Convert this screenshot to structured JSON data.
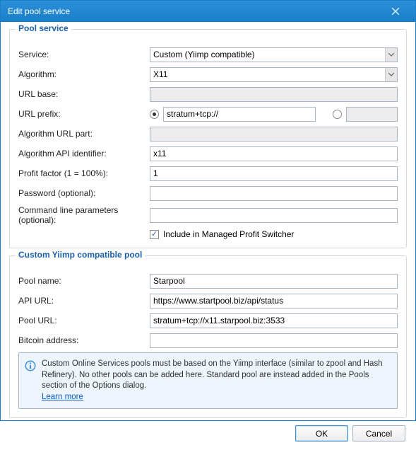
{
  "window": {
    "title": "Edit pool service"
  },
  "group1": {
    "title": "Pool service",
    "labels": {
      "service": "Service:",
      "algorithm": "Algorithm:",
      "url_base": "URL base:",
      "url_prefix": "URL prefix:",
      "algo_url_part": "Algorithm URL part:",
      "algo_api_id": "Algorithm API identifier:",
      "profit_factor": "Profit factor (1 = 100%):",
      "password": "Password (optional):",
      "cmdline": "Command line parameters (optional):"
    },
    "values": {
      "service": "Custom (Yiimp compatible)",
      "algorithm": "X11",
      "url_base": "",
      "url_prefix": "stratum+tcp://",
      "url_prefix2": "",
      "algo_url_part": "",
      "algo_api_id": "x11",
      "profit_factor": "1",
      "password": "",
      "cmdline": ""
    },
    "include_managed": "Include in Managed Profit Switcher"
  },
  "group2": {
    "title": "Custom Yiimp compatible pool",
    "labels": {
      "pool_name": "Pool name:",
      "api_url": "API URL:",
      "pool_url": "Pool URL:",
      "btc_addr": "Bitcoin address:"
    },
    "values": {
      "pool_name": "Starpool",
      "api_url": "https://www.startpool.biz/api/status",
      "pool_url": "stratum+tcp://x11.starpool.biz:3533",
      "btc_addr": ""
    },
    "info": "Custom Online Services pools must be based on the Yiimp interface (similar to zpool and Hash Refinery). No other pools can be added here. Standard pool are instead added in the Pools section of the Options dialog.",
    "learn_more": "Learn more"
  },
  "buttons": {
    "ok": "OK",
    "cancel": "Cancel"
  }
}
